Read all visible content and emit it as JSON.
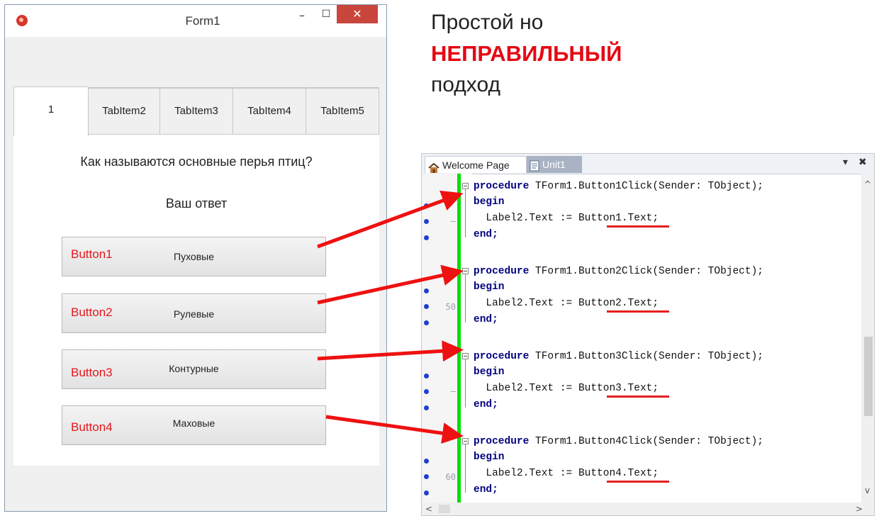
{
  "headline": {
    "line1": "Простой но",
    "line2": "НЕПРАВИЛЬНЫЙ",
    "line3": "подход"
  },
  "form_window": {
    "title": "Form1",
    "controls": {
      "minimize": "–",
      "maximize": "☐",
      "close": "✕"
    },
    "tabs": [
      "1",
      "TabItem2",
      "TabItem3",
      "TabItem4",
      "TabItem5"
    ],
    "active_tab": "1",
    "question": "Как называются основные перья птиц?",
    "answer_label": "Ваш ответ",
    "buttons": [
      {
        "name": "Button1",
        "caption": "Пуховые"
      },
      {
        "name": "Button2",
        "caption": "Рулевые"
      },
      {
        "name": "Button3",
        "caption": "Контурные"
      },
      {
        "name": "Button4",
        "caption": "Маховые"
      }
    ]
  },
  "editor": {
    "tabs": [
      {
        "label": "Welcome Page",
        "icon": "home-icon"
      },
      {
        "label": "Unit1",
        "icon": "unit-file-icon"
      }
    ],
    "controls": {
      "dropdown": "▾",
      "close": "✖"
    },
    "line_numbers": {
      "b2_line3": "50",
      "b4_line3": "60"
    },
    "gutter_marks": {
      "b1_line3": "–",
      "b3_line3": "–"
    },
    "procedures": [
      {
        "header": "TForm1.Button1Click(Sender: TObject);",
        "assign": "Label2.Text := ",
        "ref": "Button1",
        "tail": ".Text;"
      },
      {
        "header": "TForm1.Button2Click(Sender: TObject);",
        "assign": "Label2.Text := ",
        "ref": "Button2",
        "tail": ".Text;"
      },
      {
        "header": "TForm1.Button3Click(Sender: TObject);",
        "assign": "Label2.Text := ",
        "ref": "Button3",
        "tail": ".Text;"
      },
      {
        "header": "TForm1.Button4Click(Sender: TObject);",
        "assign": "Label2.Text := ",
        "ref": "Button4",
        "tail": ".Text;"
      }
    ],
    "keywords": {
      "procedure": "procedure",
      "begin": "begin",
      "end": "end;"
    },
    "scroll_arrows": {
      "up": "^",
      "down": "v",
      "left": "<",
      "right": ">"
    }
  },
  "colors": {
    "accent_red": "#e50914",
    "change_bar": "#00e000",
    "keyword": "#000080",
    "breakpoint_dot": "#1f3fd2"
  }
}
